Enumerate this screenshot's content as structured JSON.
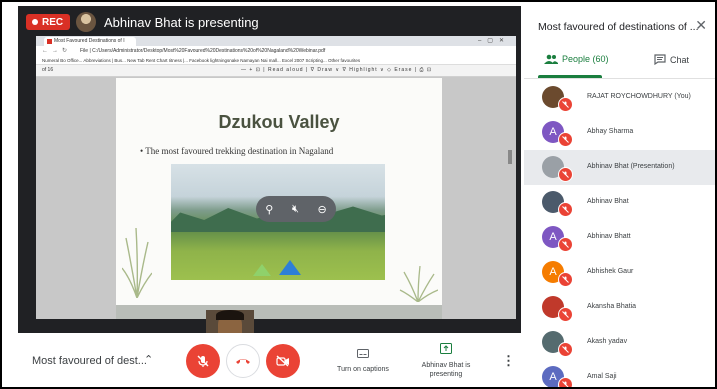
{
  "recording": {
    "label": "REC"
  },
  "presenting": {
    "title": "Abhinav Bhat is presenting"
  },
  "browser": {
    "tab_title": "Most Favoured Destinations of I",
    "url": "File | C:/Users/Administrator/Desktop/Most%20Favoured%20Destinations%20of%20Nagaland%20Webinar.pdf",
    "bookmarks": "Numeral Bo Office...  Abbreviations | Bus...  New Tab  Rent Chart Iitness |...  Facebook  lightningsnake  Namayan Nai mall...  Excel 2007 Scripting...    Other favourites",
    "page_indicator": "of 16",
    "pdf_tools": "— + ⊡ | Read aloud | ∇ Draw ∨ ∇ Highlight ∨ ◇ Erase | ⎙ ⊡"
  },
  "slide": {
    "title": "Dzukou Valley",
    "bullet": "•  The most favoured trekking destination in Nagaland"
  },
  "controls": {
    "meeting_name": "Most favoured of dest...",
    "captions_label": "Turn on captions",
    "presenter_label": "Abhinav Bhat is presenting"
  },
  "panel": {
    "title": "Most favoured of destinations of ...",
    "people_tab": "People (60)",
    "chat_tab": "Chat"
  },
  "participants": [
    {
      "name": "RAJAT ROYCHOWDHURY (You)",
      "initial": "",
      "color": "#6b4a2e"
    },
    {
      "name": "Abhay Sharma",
      "initial": "A",
      "color": "#7e57c2"
    },
    {
      "name": "Abhinav Bhat (Presentation)",
      "initial": "",
      "color": "#9aa0a6"
    },
    {
      "name": "Abhinav Bhat",
      "initial": "",
      "color": "#4b5a6b"
    },
    {
      "name": "Abhinav Bhatt",
      "initial": "A",
      "color": "#7e57c2"
    },
    {
      "name": "Abhishek Gaur",
      "initial": "A",
      "color": "#f57c00"
    },
    {
      "name": "Akansha Bhatia",
      "initial": "",
      "color": "#c0392b"
    },
    {
      "name": "Akash yadav",
      "initial": "",
      "color": "#556b6f"
    },
    {
      "name": "Amal Saji",
      "initial": "A",
      "color": "#5c6bc0"
    }
  ],
  "colors": {
    "accent_green": "#1a7e3e",
    "danger_red": "#ea4335",
    "stage_dark": "#202124"
  }
}
